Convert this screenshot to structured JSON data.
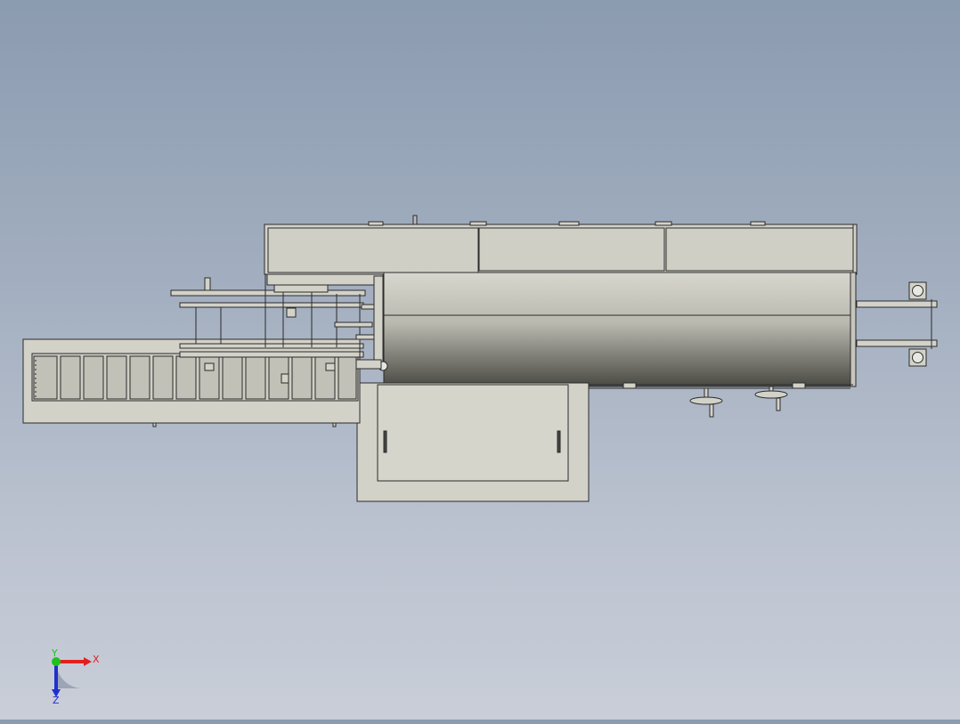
{
  "viewport": {
    "background_top": "#8b9bb0",
    "background_bottom": "#c9ced8",
    "model_fill": "#d3d2c8",
    "model_stroke": "#2b2b2b",
    "cylinder_dark": "#4a4a44",
    "cylinder_light": "#d8d7cf"
  },
  "triad": {
    "x_label": "X",
    "y_label": "Y",
    "z_label": "Z",
    "x_color": "#e02020",
    "y_color": "#20c020",
    "z_color": "#2030d0"
  }
}
